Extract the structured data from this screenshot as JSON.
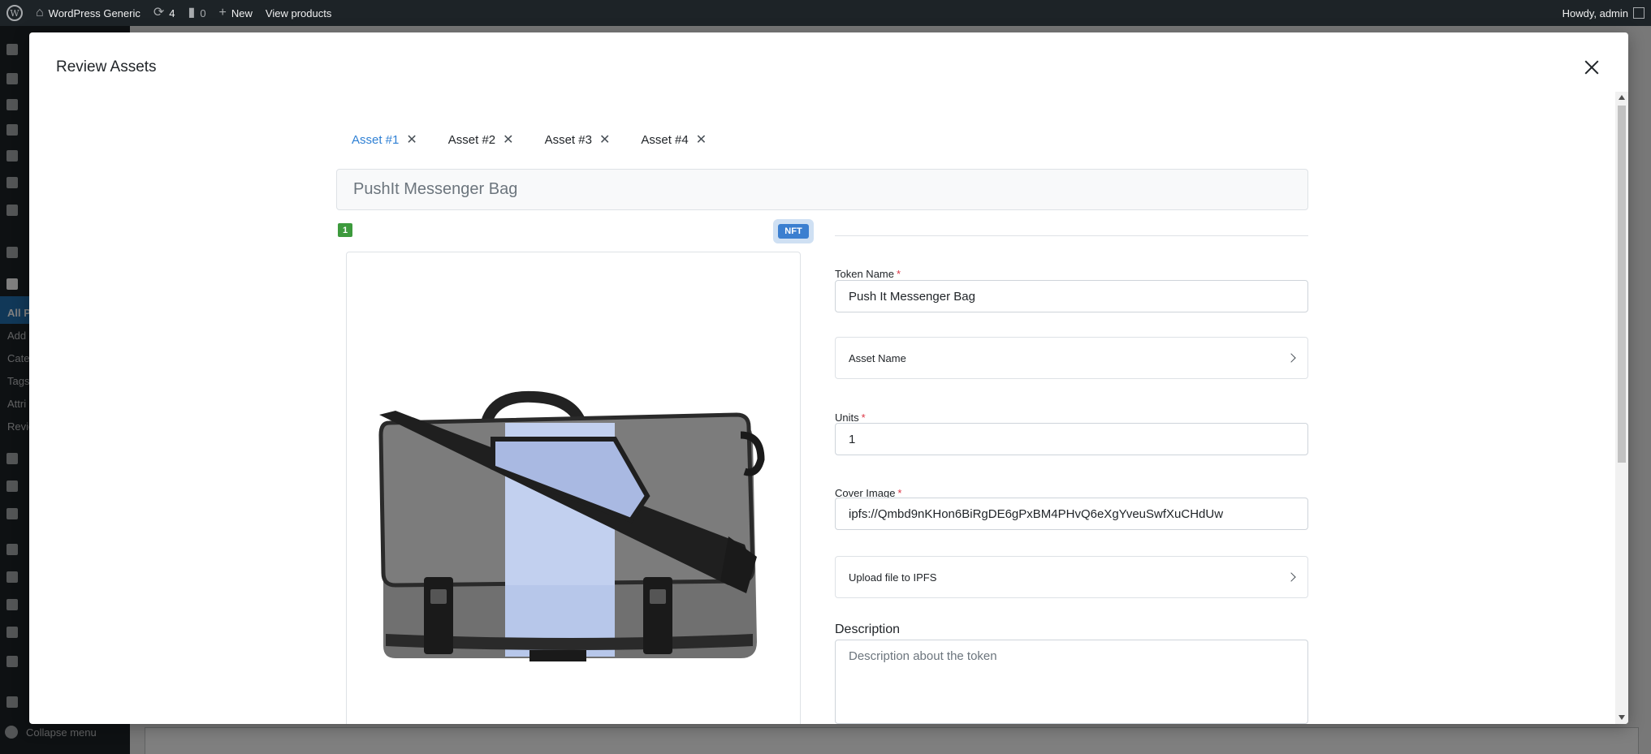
{
  "adminbar": {
    "site_name": "WordPress Generic",
    "updates_count": "4",
    "comments_count": "0",
    "new_label": "New",
    "view_products_label": "View products",
    "howdy": "Howdy, admin"
  },
  "sidebar": {
    "submenu": [
      "All P",
      "Add",
      "Cate",
      "Tags",
      "Attri",
      "Revie"
    ],
    "collapse_label": "Collapse menu"
  },
  "modal": {
    "title": "Review Assets",
    "tabs": [
      {
        "label": "Asset #1",
        "active": true
      },
      {
        "label": "Asset #2",
        "active": false
      },
      {
        "label": "Asset #3",
        "active": false
      },
      {
        "label": "Asset #4",
        "active": false
      }
    ],
    "product_name": "PushIt Messenger Bag",
    "badge_number": "1",
    "badge_type": "NFT",
    "form": {
      "token_name_label": "Token Name",
      "token_name_value": "Push It Messenger Bag",
      "asset_name_label": "Asset Name",
      "units_label": "Units",
      "units_value": "1",
      "cover_image_label": "Cover Image",
      "cover_image_value": "ipfs://Qmbd9nKHon6BiRgDE6gPxBM4PHvQ6eXgYveuSwfXuCHdUw",
      "upload_label": "Upload file to IPFS",
      "description_label": "Description",
      "description_placeholder": "Description about the token"
    }
  },
  "colors": {
    "accent": "#2f80d4",
    "badge_green": "#3d9a3d",
    "required": "#dc3545"
  }
}
